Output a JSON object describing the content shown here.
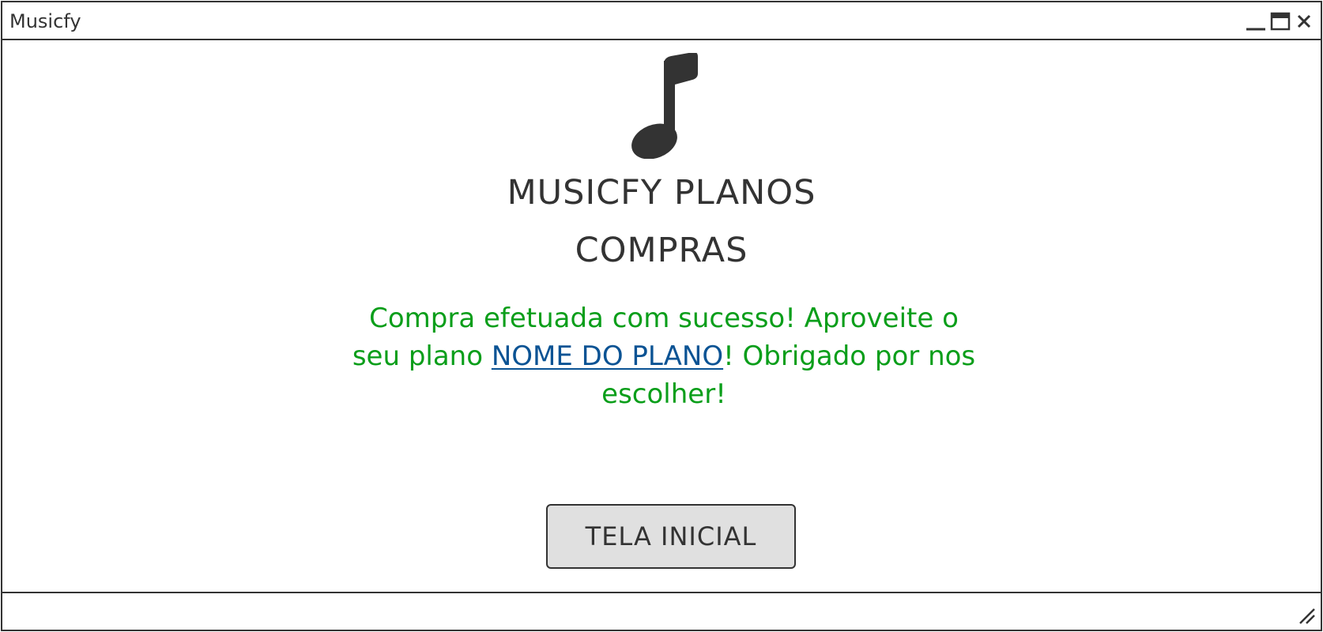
{
  "window": {
    "title": "Musicfy",
    "controls": {
      "minimize_icon": "minimize-icon",
      "maximize_icon": "maximize-icon",
      "close_icon": "close-icon"
    }
  },
  "main": {
    "logo_icon": "music-note-icon",
    "title": "MUSICFY PLANOS",
    "subtitle": "COMPRAS",
    "message": {
      "before": "Compra efetuada com sucesso! Aproveite o seu plano ",
      "plan_name": "NOME DO PLANO",
      "after": "! Obrigado por nos escolher!"
    },
    "home_button_label": "TELA INICIAL"
  },
  "statusbar": {
    "resize_icon": "resize-grip-icon"
  },
  "colors": {
    "text": "#333333",
    "success": "#0a9e1a",
    "link": "#0b5394",
    "button_bg": "#e0e0e0"
  }
}
